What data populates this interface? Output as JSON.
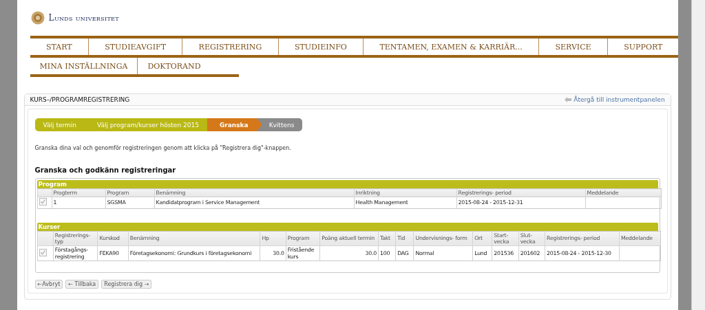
{
  "logo": {
    "text": "Lunds universitet"
  },
  "nav": {
    "primary": [
      {
        "label": "START"
      },
      {
        "label": "STUDIEAVGIFT"
      },
      {
        "label": "REGISTRERING"
      },
      {
        "label": "STUDIEINFO"
      },
      {
        "label": "TENTAMEN, EXAMEN & KARRIÄR..."
      },
      {
        "label": "SERVICE"
      },
      {
        "label": "SUPPORT"
      }
    ],
    "secondary": [
      {
        "label": "MINA INSTÄLLNINGA"
      },
      {
        "label": "DOKTORAND"
      }
    ]
  },
  "panel": {
    "title": "KURS–/PROGRAMREGISTRERING",
    "back_link": "Återgå till instrumentpanelen"
  },
  "steps": [
    {
      "label": "Välj termin",
      "done": true,
      "selected": false
    },
    {
      "label": "Välj program/kurser hösten 2015",
      "done": true,
      "selected": false
    },
    {
      "label": "Granska",
      "done": false,
      "selected": true
    },
    {
      "label": "Kvittens",
      "done": false,
      "selected": false
    }
  ],
  "instruction": "Granska dina val och genomför registreringen genom att klicka på \"Registrera dig\"-knappen.",
  "section_title": "Granska och godkänn registreringar",
  "tables": [
    {
      "title": "Program",
      "columns": [
        "Progterm",
        "Program",
        "Benämning",
        "Inriktning",
        "Registrerings- period",
        "Meddelande"
      ],
      "rows": [
        {
          "checked": true,
          "cells": [
            "1",
            "SGSMA",
            "Kandidatprogram i Service Management",
            "Health Management",
            "2015-08-24 - 2015-12-31",
            ""
          ]
        }
      ]
    },
    {
      "title": "Kurser",
      "columns": [
        "Registrerings- typ",
        "Kurskod",
        "Benämning",
        "Hp",
        "Program",
        "Poäng aktuell termin",
        "Takt",
        "Tid",
        "Undervisnings- form",
        "Ort",
        "Start- vecka",
        "Slut- vecka",
        "Registrerings- period",
        "Meddelande"
      ],
      "rows": [
        {
          "checked": true,
          "cells": [
            "Förstagångs- registrering",
            "FEKA90",
            "Företagsekonomi: Grundkurs i företagsekonomi",
            "30.0",
            "Fristående kurs",
            "30.0",
            "100",
            "DAG",
            "Normal",
            "Lund",
            "201536",
            "201602",
            "2015-08-24 - 2015-12-30",
            ""
          ]
        }
      ]
    }
  ],
  "buttons": [
    "←Avbryt",
    "← Tillbaka",
    "Registrera dig →"
  ]
}
